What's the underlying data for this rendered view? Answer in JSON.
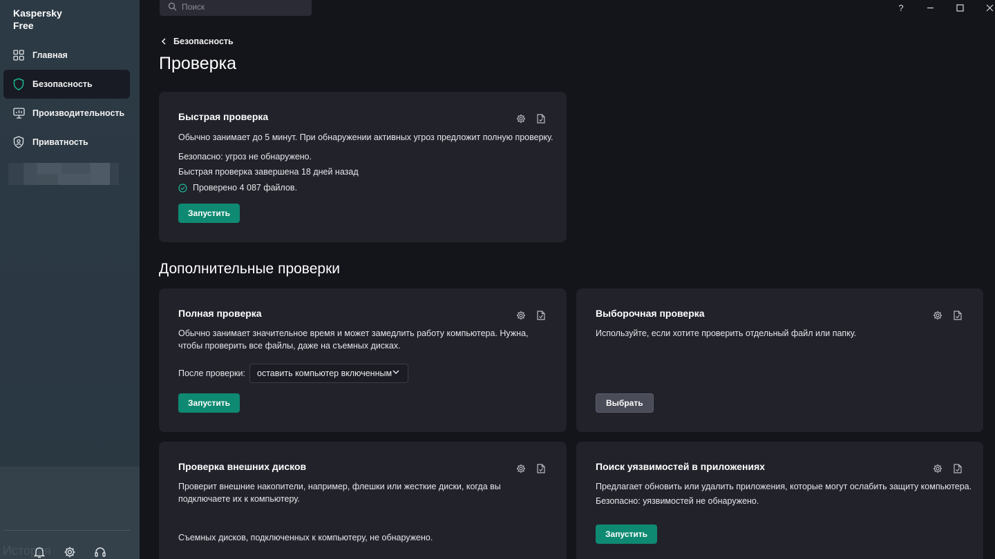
{
  "app": {
    "brand": "Kaspersky\nFree"
  },
  "sidebar": {
    "items": [
      {
        "label": "Главная",
        "icon": "grid-icon"
      },
      {
        "label": "Безопасность",
        "icon": "shield-icon",
        "active": true
      },
      {
        "label": "Производительность",
        "icon": "monitor-icon"
      },
      {
        "label": "Приватность",
        "icon": "privacy-shield-icon"
      }
    ],
    "bottom": {
      "history_label": "История"
    }
  },
  "search": {
    "placeholder": "Поиск"
  },
  "window": {
    "help": "?"
  },
  "breadcrumb": {
    "back_label": "Безопасность"
  },
  "page": {
    "title": "Проверка",
    "section_title": "Дополнительные проверки"
  },
  "quick_scan": {
    "title": "Быстрая проверка",
    "description": "Обычно занимает до 5 минут. При обнаружении активных угроз предложит полную проверку.",
    "status": "Безопасно: угроз не обнаружено.",
    "last_run": "Быстрая проверка завершена 18 дней назад",
    "files_checked": "Проверено 4 087 файлов.",
    "button": "Запустить"
  },
  "full_scan": {
    "title": "Полная проверка",
    "description": "Обычно занимает значительное время и может замедлить работу компьютера. Нужна, чтобы проверить все файлы, даже на съемных дисках.",
    "after_label": "После проверки:",
    "after_value": "оставить компьютер включенным",
    "button": "Запустить"
  },
  "custom_scan": {
    "title": "Выборочная проверка",
    "description": "Используйте, если хотите проверить отдельный файл или папку.",
    "button": "Выбрать"
  },
  "external_scan": {
    "title": "Проверка внешних дисков",
    "description": "Проверит внешние накопители, например, флешки или жесткие диски, когда вы подключаете их к компьютеру.",
    "status": "Съемных дисков, подключенных к компьютеру, не обнаружено."
  },
  "vuln_scan": {
    "title": "Поиск уязвимостей в приложениях",
    "description": "Предлагает обновить или удалить приложения, которые могут ослабить защиту компьютера.",
    "status": "Безопасно: уязвимостей не обнаружено.",
    "button": "Запустить"
  },
  "colors": {
    "accent": "#0f8a72",
    "sidebar": "#2c3a45",
    "background": "#14141b",
    "card": "#22222b"
  }
}
